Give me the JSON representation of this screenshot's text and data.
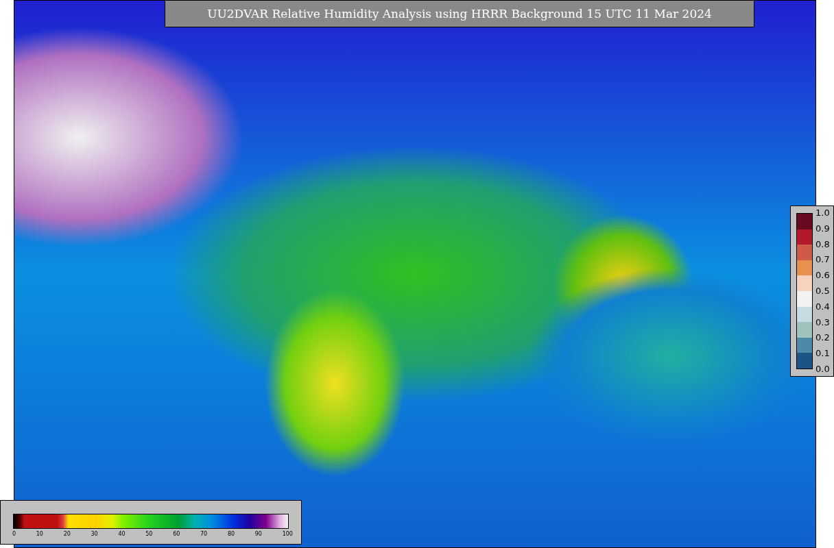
{
  "title": "UU2DVAR Relative Humidity Analysis using HRRR Background 15 UTC 11 Mar 2024",
  "station_legend": {
    "ticks": [
      "1.0",
      "0.9",
      "0.8",
      "0.7",
      "0.6",
      "0.5",
      "0.4",
      "0.3",
      "0.2",
      "0.1",
      "0.0"
    ],
    "bands": [
      {
        "color": "#6a0a20"
      },
      {
        "color": "#b3182b"
      },
      {
        "color": "#d05a48"
      },
      {
        "color": "#e8914f"
      },
      {
        "color": "#f7d2bd"
      },
      {
        "color": "#f2f2f2"
      },
      {
        "color": "#c7dce2"
      },
      {
        "color": "#9fc4be"
      },
      {
        "color": "#4e8aa8"
      },
      {
        "color": "#1c5486"
      }
    ]
  },
  "colorbar": {
    "ticks": [
      "0",
      "10",
      "20",
      "30",
      "40",
      "50",
      "60",
      "70",
      "80",
      "90",
      "100"
    ]
  }
}
